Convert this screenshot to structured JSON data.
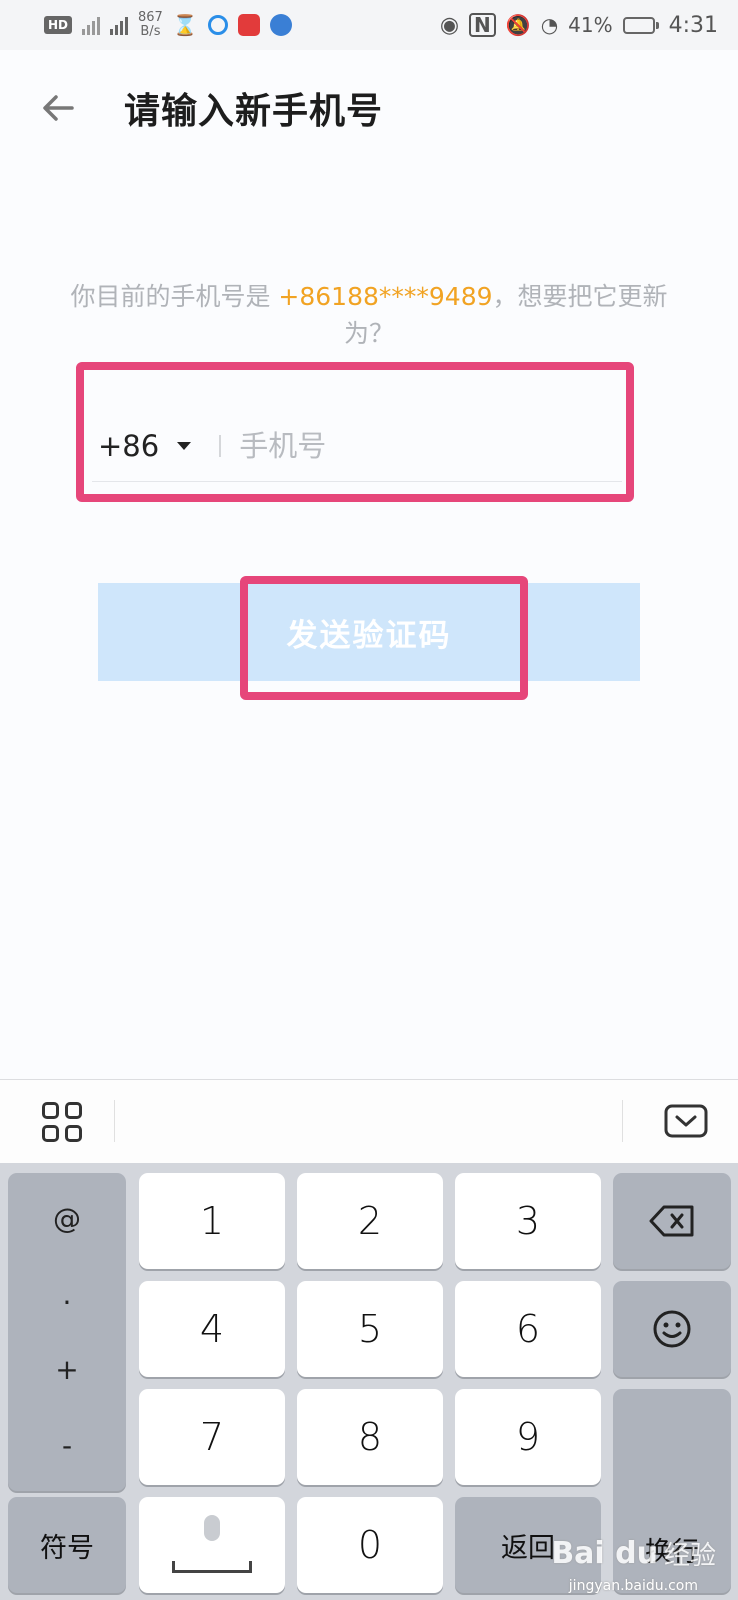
{
  "status_bar": {
    "hd_badge": "HD",
    "speed_value": "867",
    "speed_unit": "B/s",
    "battery_percent": "41%",
    "time": "4:31",
    "battery_fraction": 0.41
  },
  "header": {
    "title": "请输入新手机号"
  },
  "prompt": {
    "prefix": "你目前的手机号是 ",
    "current_phone": "+86188****9489",
    "suffix": "，想要把它更新为？"
  },
  "phone_input": {
    "country_code": "+86",
    "placeholder": "手机号",
    "value": ""
  },
  "send_button": {
    "label": "发送验证码"
  },
  "keyboard": {
    "symbols": [
      "@",
      ".",
      "+",
      "-"
    ],
    "digits": [
      "1",
      "2",
      "3",
      "4",
      "5",
      "6",
      "7",
      "8",
      "9"
    ],
    "zero": "0",
    "symbol_key": "符号",
    "return_key": "返回",
    "enter_key": "换行"
  },
  "watermark": {
    "logo": "Bai du",
    "text": "经验",
    "sub": "jingyan.baidu.com"
  },
  "colors": {
    "highlight": "#e6467a",
    "phone_accent": "#f1a323",
    "button_bg": "#cfe6fb"
  }
}
